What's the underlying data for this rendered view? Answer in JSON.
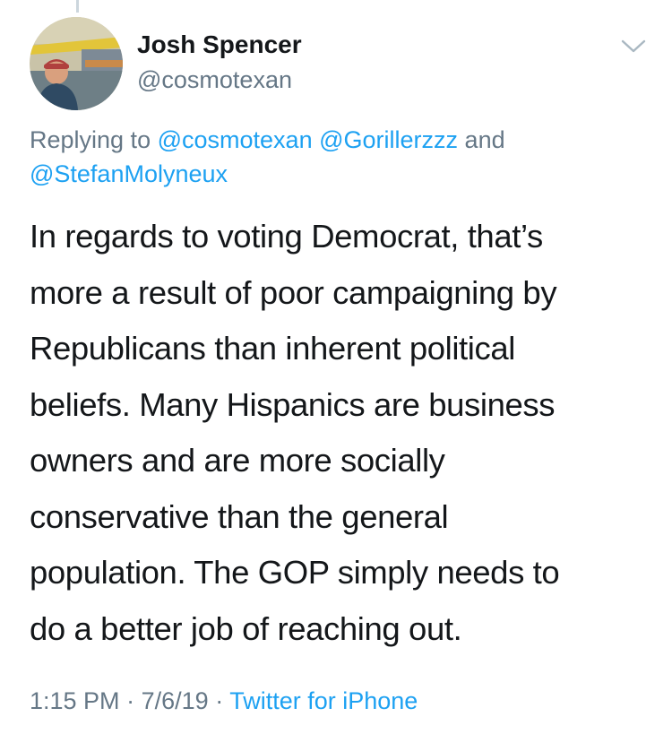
{
  "author": {
    "name": "Josh Spencer",
    "handle": "@cosmotexan"
  },
  "reply_context": {
    "prefix": "Replying to",
    "mention_1": "@cosmotexan",
    "mention_2": "@Gorillerzzz",
    "conjunction": "and",
    "mention_3": "@StefanMolyneux"
  },
  "tweet": {
    "lines": [
      "In regards to voting Democrat, that’s",
      "more a result of poor campaigning by",
      "Republicans than inherent political",
      "beliefs. Many Hispanics are business",
      "owners and are more socially",
      "conservative than the general",
      "population. The GOP simply needs to",
      "do a better job of reaching out."
    ]
  },
  "meta": {
    "time": "1:15 PM",
    "separator": "·",
    "date": "7/6/19",
    "source": "Twitter for iPhone"
  },
  "icons": {
    "menu": "chevron-down-icon"
  },
  "colors": {
    "text": "#14171a",
    "secondary": "#657786",
    "link": "#1da1f2"
  }
}
